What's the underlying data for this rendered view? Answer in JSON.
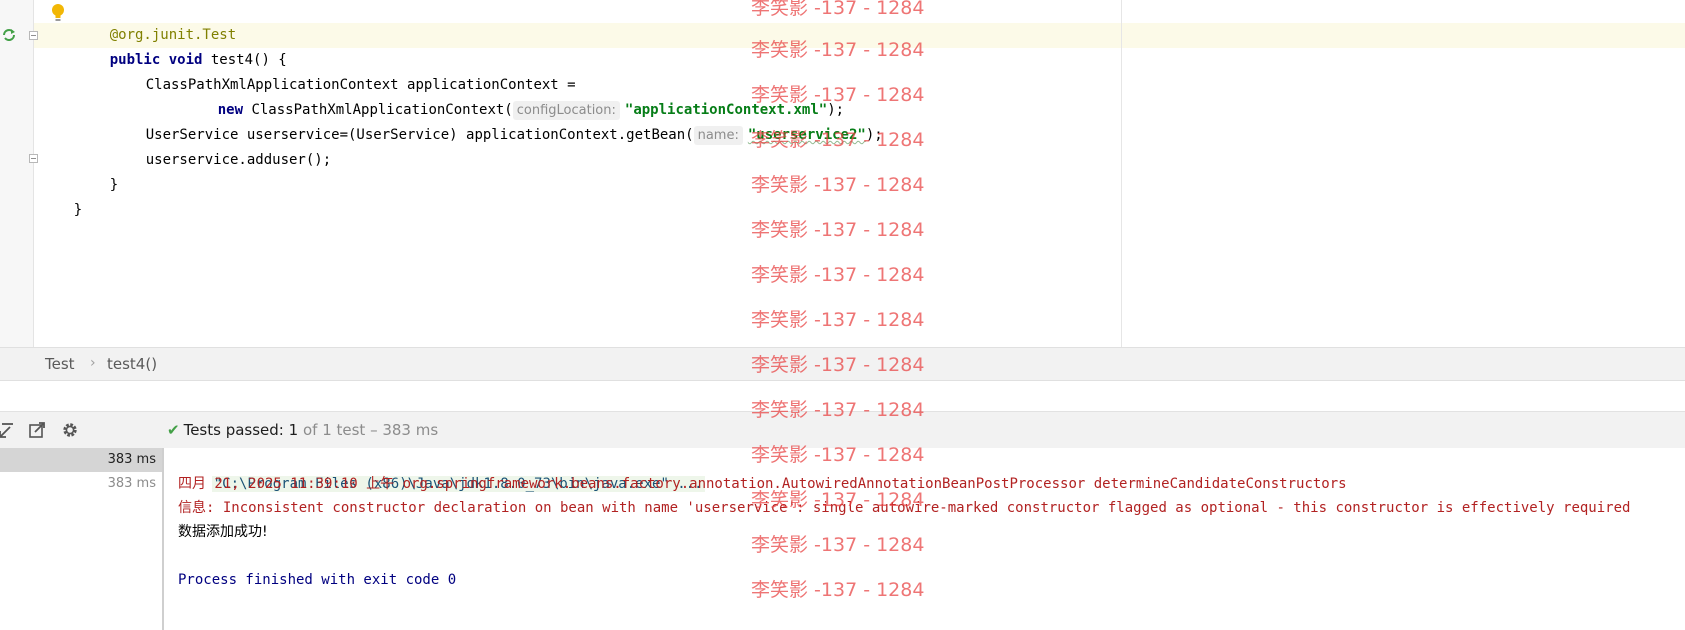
{
  "editor": {
    "lines": {
      "l0_annotation": "@org.junit.Test",
      "l1_kw": "public void",
      "l1_rest": " test4() {",
      "l2": "ClassPathXmlApplicationContext applicationContext =",
      "l3_kw": "new",
      "l3_rest": " ClassPathXmlApplicationContext(",
      "l3_hint": "configLocation:",
      "l3_str": "\"applicationContext.xml\"",
      "l3_end": ");",
      "l4_rest": "UserService userservice=(UserService) applicationContext.getBean(",
      "l4_hint": "name:",
      "l4_str": "\"userservice2\"",
      "l4_end": ");",
      "l5": "userservice.adduser();",
      "l6": "}",
      "l7": "}"
    },
    "icons": {
      "bulb": "lightbulb-icon",
      "run": "run-test-icon",
      "fold": "fold-icon"
    }
  },
  "breadcrumb": {
    "items": [
      "Test",
      "test4()"
    ],
    "separator": "›"
  },
  "run_panel": {
    "status_prefix": "Tests passed:",
    "status_count": "1",
    "status_suffix": "of 1 test – 383 ms",
    "tree": [
      {
        "duration": "383 ms"
      },
      {
        "duration": "383 ms"
      }
    ],
    "console": {
      "cmd": "\"C:\\Program Files (x86)\\Java\\jdk1.8.0_73\\bin\\java.exe\" ...",
      "log1": "四月 21, 2025 11:39:10 上午 org.springframework.beans.factory.annotation.AutowiredAnnotationBeanPostProcessor determineCandidateConstructors",
      "log2": "信息: Inconsistent constructor declaration on bean with name 'userservice': single autowire-marked constructor flagged as optional - this constructor is effectively required",
      "out": "数据添加成功!",
      "exit": "Process finished with exit code 0"
    }
  },
  "watermark": {
    "text": "李笑影 -137 - 1284",
    "color": "#e84040"
  },
  "colors": {
    "keyword": "#000080",
    "string": "#067d17",
    "annotation": "#808000",
    "success": "#43a047",
    "error_log": "#b22222"
  }
}
